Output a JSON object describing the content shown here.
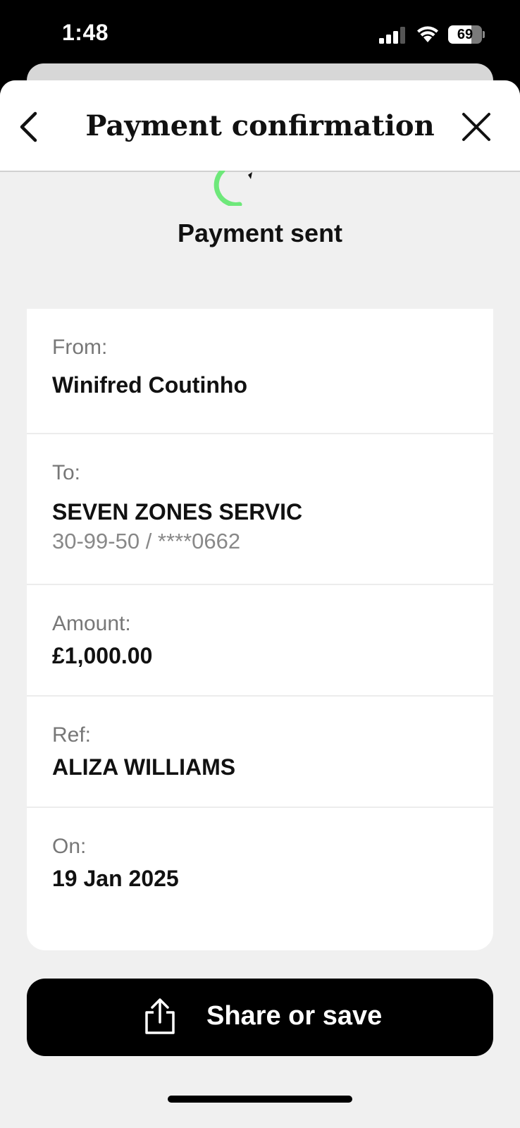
{
  "status_bar": {
    "time": "1:48",
    "battery": "69",
    "battery_level": 0.69
  },
  "nav": {
    "title": "Payment confirmation",
    "back_icon": "chevron-left-icon",
    "close_icon": "close-icon"
  },
  "result": {
    "title": "Payment sent",
    "icon": "checkmark-circle-icon",
    "accent": "#6EE87A"
  },
  "details": {
    "from": {
      "label": "From:",
      "value": "Winifred Coutinho"
    },
    "to": {
      "label": "To:",
      "value": "SEVEN ZONES SERVIC",
      "account": "30-99-50 / ****0662"
    },
    "amount": {
      "label": "Amount:",
      "value": "£1,000.00"
    },
    "ref": {
      "label": "Ref:",
      "value": "ALIZA WILLIAMS"
    },
    "on": {
      "label": "On:",
      "value": "19 Jan 2025"
    }
  },
  "actions": {
    "share_label": "Share or save",
    "share_icon": "share-icon"
  }
}
